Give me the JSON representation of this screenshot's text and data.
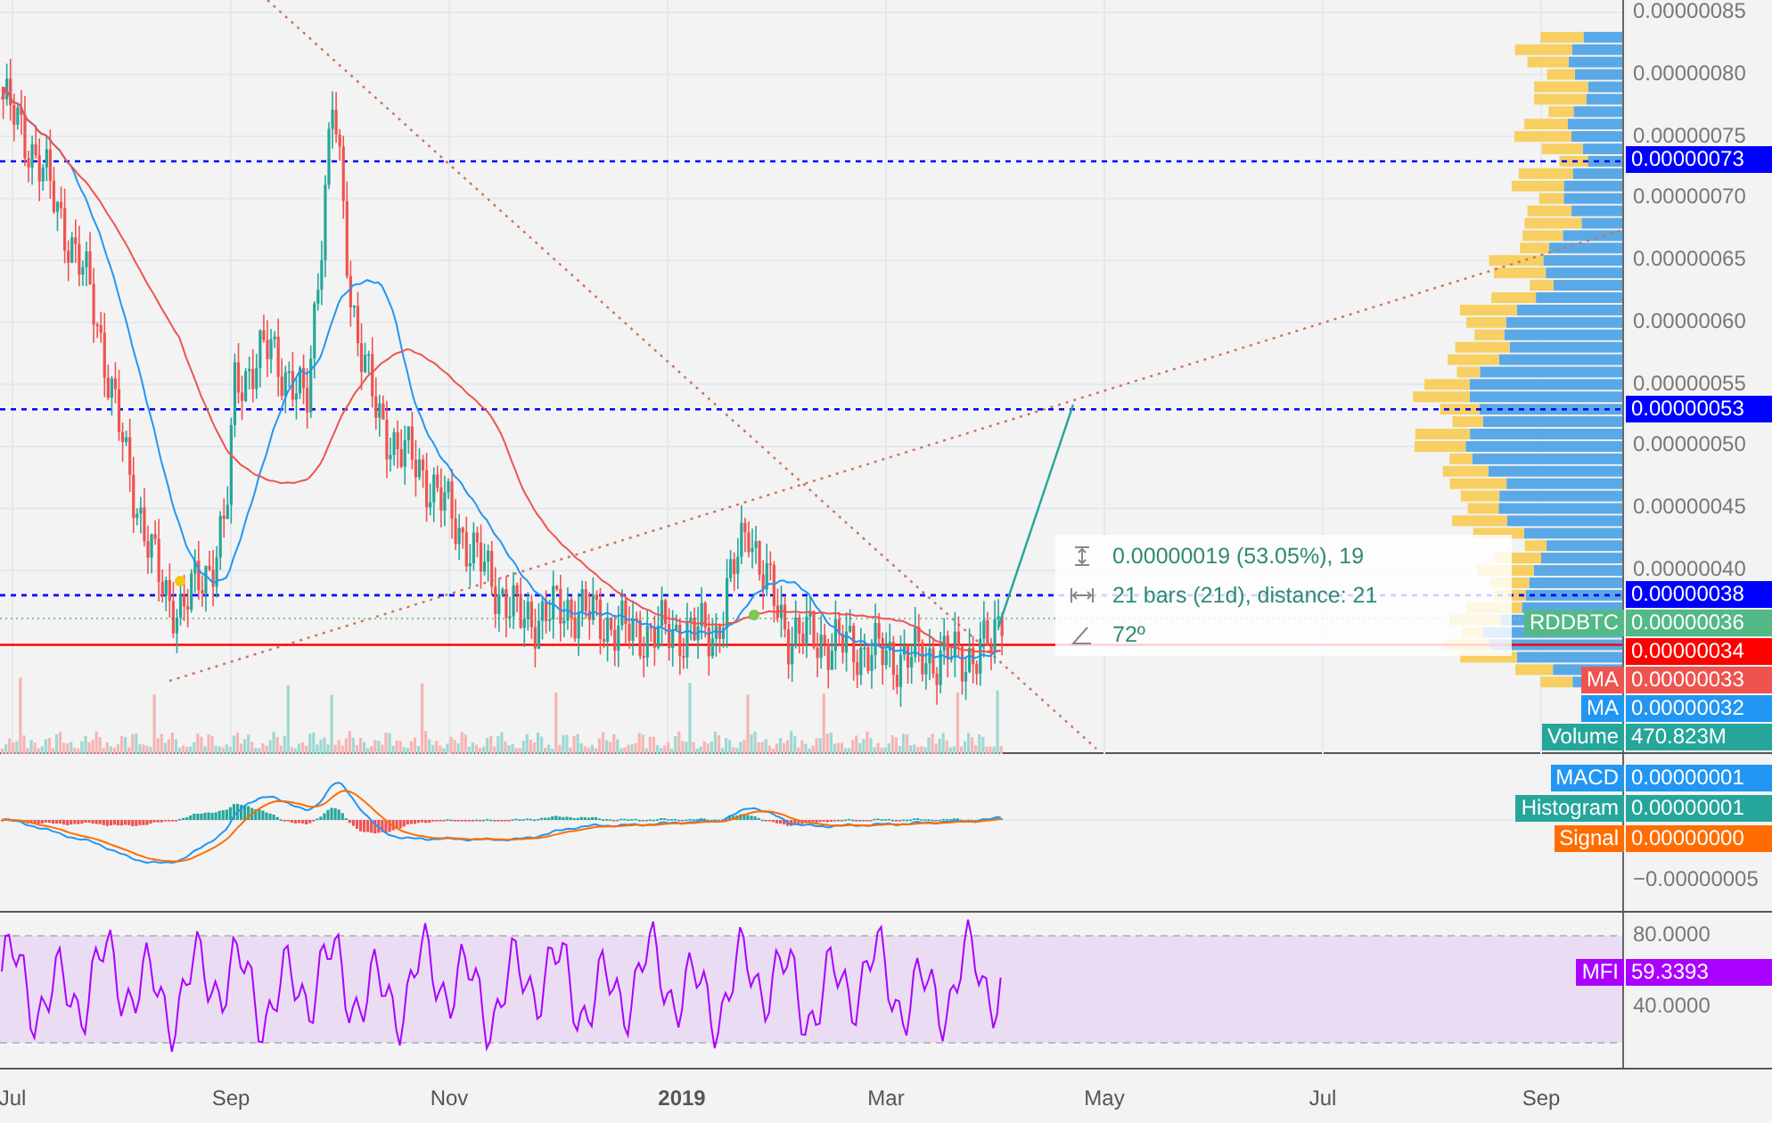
{
  "price_axis": {
    "ticks": [
      "0.00000085",
      "0.00000080",
      "0.00000075",
      "0.00000070",
      "0.00000065",
      "0.00000060",
      "0.00000055",
      "0.00000050",
      "0.00000045",
      "0.00000040"
    ]
  },
  "price_tags": [
    {
      "kind": "price",
      "value": "0.00000073",
      "color": "#0000ff",
      "dashed_line": true
    },
    {
      "kind": "price",
      "value": "0.00000053",
      "color": "#0000ff",
      "dashed_line": true
    },
    {
      "kind": "price",
      "value": "0.00000038",
      "color": "#0000ff",
      "dashed_line": true
    },
    {
      "kind": "price",
      "name": "RDDBTC",
      "value": "0.00000036",
      "color": "#53b987"
    },
    {
      "kind": "price",
      "value": "0.00000034",
      "color": "#ff0000",
      "solid_line": true
    },
    {
      "kind": "price",
      "name": "MA",
      "value": "0.00000033",
      "color": "#ef5350"
    },
    {
      "kind": "price",
      "name": "MA",
      "value": "0.00000032",
      "color": "#2196f3"
    },
    {
      "kind": "volume",
      "name": "Volume",
      "value": "470.823M",
      "color": "#26a69a"
    }
  ],
  "measure_tooltip": [
    {
      "kind": "range",
      "text": "0.00000019 (53.05%), 19"
    },
    {
      "kind": "bars",
      "text": "21 bars (21d), distance: 21"
    },
    {
      "kind": "angle",
      "text": "72º"
    }
  ],
  "macd_tags": [
    {
      "name": "MACD",
      "value": "0.00000001",
      "color": "#2196f3"
    },
    {
      "name": "Histogram",
      "value": "0.00000001",
      "color": "#26a69a"
    },
    {
      "name": "Signal",
      "value": "0.00000000",
      "color": "#ff6d00"
    }
  ],
  "macd_axis": {
    "ticks": [
      "−0.00000005"
    ]
  },
  "mfi_axis": {
    "ticks": [
      "80.0000",
      "40.0000"
    ]
  },
  "mfi_tag": {
    "name": "MFI",
    "value": "59.3393",
    "color": "#aa00ff"
  },
  "time_axis": [
    {
      "label": "Jul",
      "kind": "month"
    },
    {
      "label": "Sep",
      "kind": "month"
    },
    {
      "label": "Nov",
      "kind": "month"
    },
    {
      "label": "2019",
      "kind": "year"
    },
    {
      "label": "Mar",
      "kind": "month"
    },
    {
      "label": "May",
      "kind": "month"
    },
    {
      "label": "Jul",
      "kind": "month"
    },
    {
      "label": "Sep",
      "kind": "month"
    }
  ]
}
